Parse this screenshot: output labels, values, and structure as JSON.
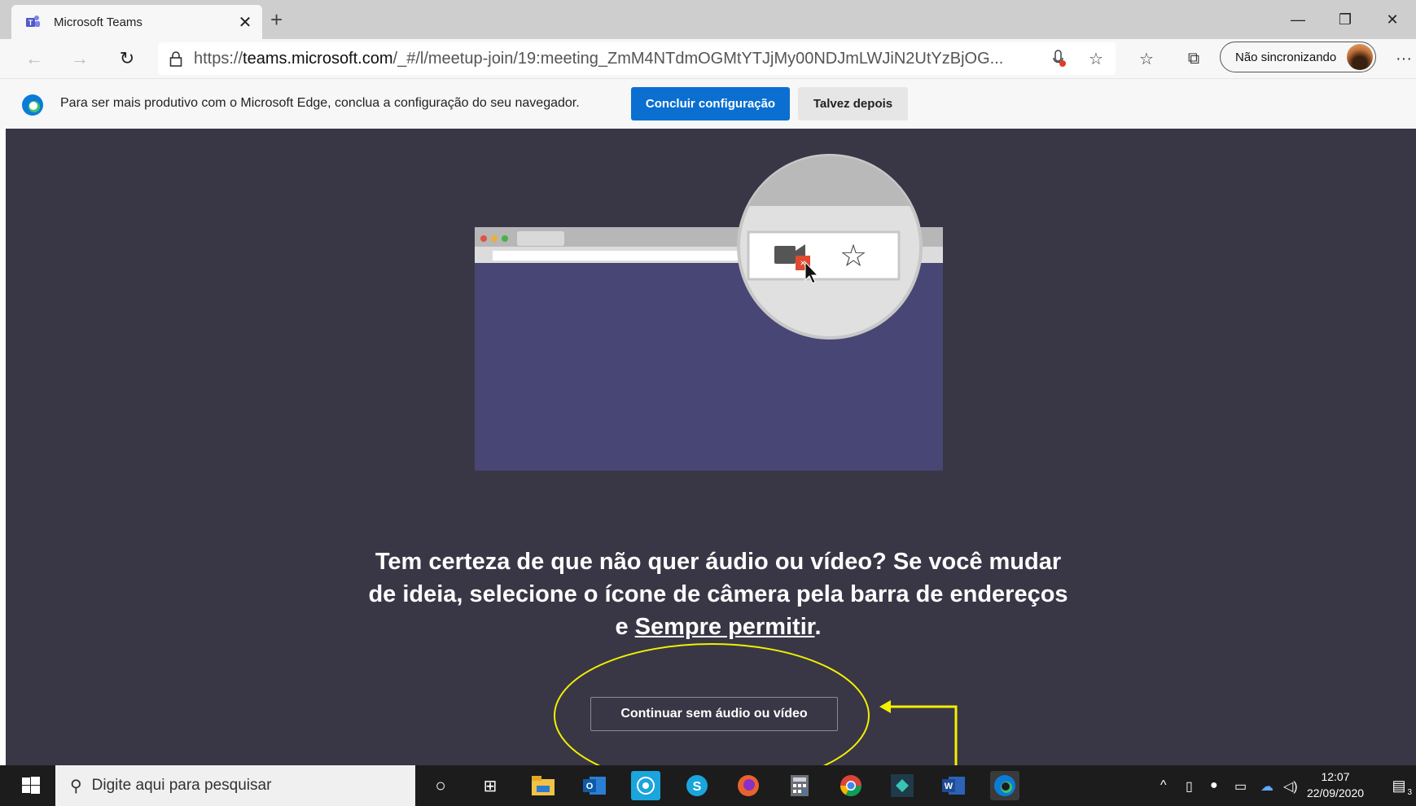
{
  "browser": {
    "tab_title": "Microsoft Teams",
    "tab_close": "✕",
    "new_tab": "+",
    "url_prefix": "https://",
    "url_domain": "teams.microsoft.com",
    "url_path": "/_#/l/meetup-join/19:meeting_ZmM4NTdmOGMtYTJjMy00NDJmLWJiN2UtYzBjOG...",
    "sync_label": "Não sincronizando",
    "more": "···"
  },
  "infobar": {
    "text": "Para ser mais produtivo com o Microsoft Edge, conclua a configuração do seu navegador.",
    "primary": "Concluir configuração",
    "secondary": "Talvez depois"
  },
  "main": {
    "message_part1": "Tem certeza de que não quer áudio ou vídeo? Se você mudar de ideia, selecione o ícone de câmera pela barra de endereços e ",
    "message_link": "Sempre permitir",
    "message_end": ".",
    "continue_button": "Continuar sem áudio ou vídeo"
  },
  "taskbar": {
    "search_placeholder": "Digite aqui para pesquisar",
    "time": "12:07",
    "date": "22/09/2020",
    "notification_count": "3"
  },
  "colors": {
    "content_bg": "#393746",
    "primary_button": "#0a6fd1",
    "annotation": "#f3f000"
  },
  "icons": [
    "teams-icon",
    "back-icon",
    "forward-icon",
    "refresh-icon",
    "lock-icon",
    "mic-blocked-icon",
    "star-icon",
    "favorites-icon",
    "collections-icon",
    "edge-icon",
    "windows-start-icon",
    "search-icon",
    "cortana-icon",
    "task-view-icon",
    "file-explorer-icon",
    "outlook-icon",
    "whatsapp-icon",
    "skype-icon",
    "firefox-icon",
    "calculator-icon",
    "chrome-icon",
    "kodi-icon",
    "word-icon",
    "edge-taskbar-icon"
  ]
}
